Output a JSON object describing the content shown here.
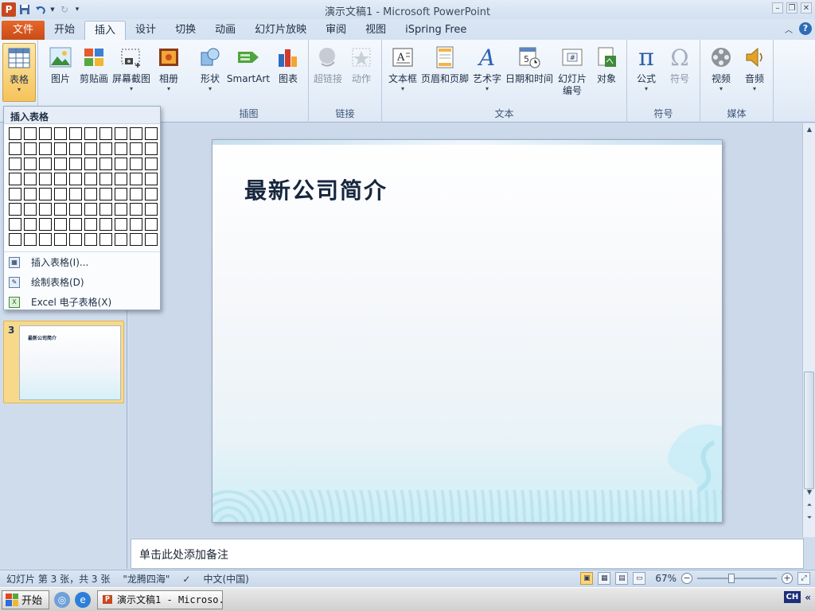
{
  "window": {
    "title": "演示文稿1 - Microsoft PowerPoint"
  },
  "qat": {
    "app_icon": "P",
    "save_icon": "save-icon",
    "undo_icon": "undo-icon",
    "redo_icon": "redo-icon",
    "customize_icon": "customize-qat-icon"
  },
  "tabs": {
    "file": "文件",
    "home": "开始",
    "insert": "插入",
    "design": "设计",
    "transitions": "切换",
    "animations": "动画",
    "slideshow": "幻灯片放映",
    "review": "审阅",
    "view": "视图",
    "ispring": "iSpring Free"
  },
  "ribbon": {
    "table": "表格",
    "picture": "图片",
    "clipart": "剪贴画",
    "screenshot": "屏幕截图",
    "album": "相册",
    "shapes": "形状",
    "smartart": "SmartArt",
    "chart": "图表",
    "hyperlink": "超链接",
    "action": "动作",
    "textbox": "文本框",
    "header_footer": "页眉和页脚",
    "wordart": "艺术字",
    "datetime": "日期和时间",
    "slidenum_line1": "幻灯片",
    "slidenum_line2": "编号",
    "object": "对象",
    "equation": "公式",
    "symbol": "符号",
    "video": "视频",
    "audio": "音频",
    "group_illustrations": "插图",
    "group_links": "链接",
    "group_text": "文本",
    "group_symbols": "符号",
    "group_media": "媒体"
  },
  "dropdown": {
    "header": "插入表格",
    "rows": 8,
    "cols": 10,
    "item_insert": "插入表格(I)...",
    "item_draw": "绘制表格(D)",
    "item_excel": "Excel 电子表格(X)"
  },
  "thumbnail": {
    "number": "3",
    "title": "最新公司简介"
  },
  "slide": {
    "title": "最新公司简介"
  },
  "notes": {
    "placeholder": "单击此处添加备注"
  },
  "status": {
    "slide_info": "幻灯片 第 3 张，共 3 张",
    "theme": "\"龙腾四海\"",
    "language": "中文(中国)",
    "zoom": "67%",
    "zoom_fraction": 0.42
  },
  "taskbar": {
    "start": "开始",
    "app": "演示文稿1 - Microso...",
    "ime": "CH",
    "expand": "«"
  },
  "colors": {
    "file_tab": "#d5561f",
    "accent": "#2e6db5",
    "pressed": "#f6c35b"
  }
}
